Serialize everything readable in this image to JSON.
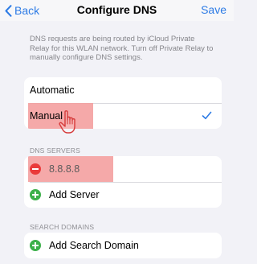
{
  "nav": {
    "back_label": "Back",
    "title": "Configure DNS",
    "save_label": "Save"
  },
  "info_text": "DNS requests are being routed by iCloud Private Relay for this WLAN network. Turn off Private Relay to manually configure DNS settings.",
  "mode": {
    "options": [
      "Automatic",
      "Manual"
    ],
    "selected": "Manual"
  },
  "dns_servers": {
    "header": "DNS SERVERS",
    "servers": [
      "8.8.8.8"
    ],
    "add_label": "Add Server"
  },
  "search_domains": {
    "header": "SEARCH DOMAINS",
    "add_label": "Add Search Domain"
  },
  "colors": {
    "accent": "#2d7be5",
    "highlight": "#f39a9a",
    "remove": "#ea3b3b",
    "add": "#3cb04a"
  }
}
